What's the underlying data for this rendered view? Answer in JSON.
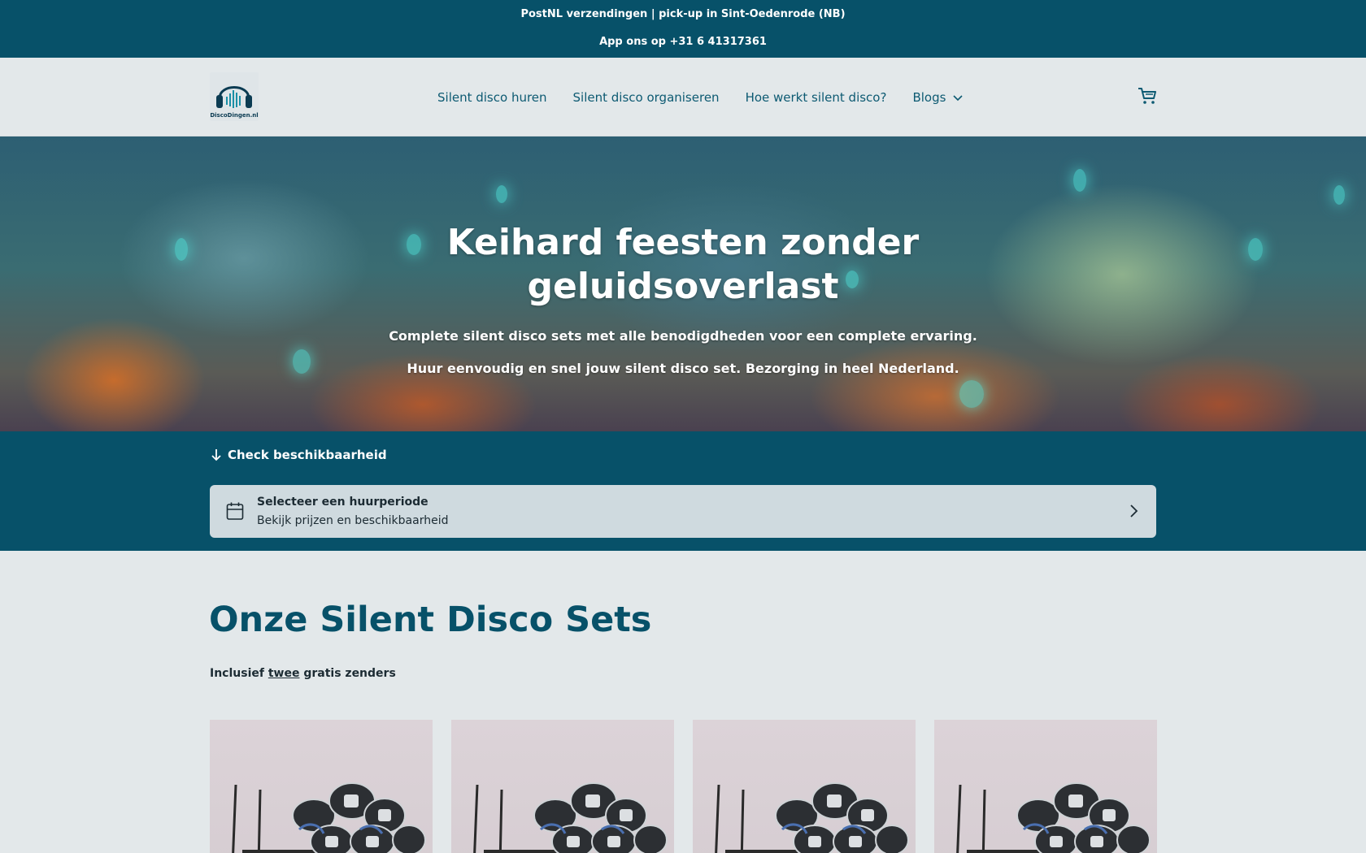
{
  "topbar": {
    "line1": "PostNL verzendingen | pick-up in Sint-Oedenrode (NB)",
    "line2": "App ons op +31 6 41317361"
  },
  "header": {
    "logo_text": "DiscoDingen.nl",
    "nav": [
      {
        "label": "Silent disco huren"
      },
      {
        "label": "Silent disco organiseren"
      },
      {
        "label": "Hoe werkt silent disco?"
      },
      {
        "label": "Blogs"
      }
    ],
    "cart_icon": "cart-icon"
  },
  "hero": {
    "title_line1": "Keihard feesten zonder",
    "title_line2": "geluidsoverlast",
    "subtitle1": "Complete silent disco sets met alle benodigdheden voor een complete ervaring.",
    "subtitle2": "Huur eenvoudig en snel jouw silent disco set. Bezorging in heel Nederland."
  },
  "availability": {
    "check_label": "Check beschikbaarheid",
    "period_title": "Selecteer een huurperiode",
    "period_subtitle": "Bekijk prijzen en beschikbaarheid"
  },
  "sets": {
    "heading": "Onze Silent Disco Sets",
    "sub_prefix": "Inclusief ",
    "sub_link": "twee",
    "sub_suffix": " gratis zenders",
    "cards": [
      {
        "image": "silent-disco-set-image"
      },
      {
        "image": "silent-disco-set-image"
      },
      {
        "image": "silent-disco-set-image"
      },
      {
        "image": "silent-disco-set-image"
      }
    ]
  },
  "colors": {
    "primary": "#075169",
    "background": "#e3e8ea",
    "nav_text": "#0d5a72"
  }
}
